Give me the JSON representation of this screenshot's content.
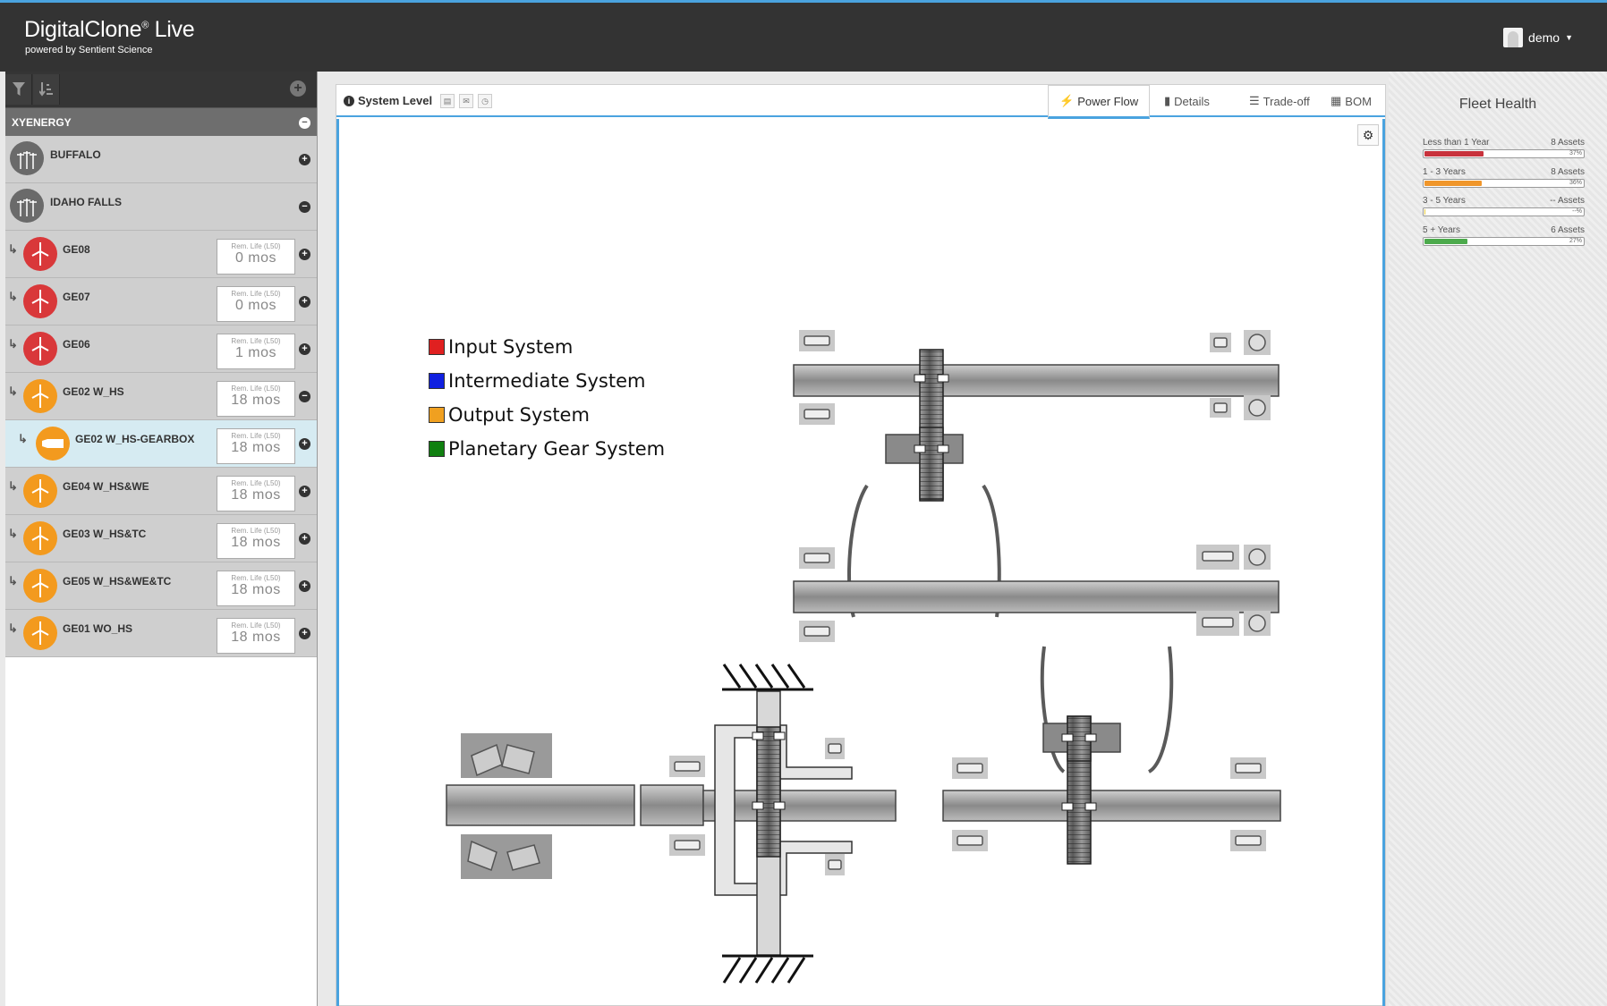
{
  "app": {
    "title": "DigitalClone",
    "title_reg": "®",
    "title_suffix": " Live",
    "subtitle": "powered by Sentient Science",
    "user": "demo"
  },
  "sidebar": {
    "group": "XYENERGY",
    "sites": [
      {
        "name": "BUFFALO"
      },
      {
        "name": "IDAHO FALLS"
      }
    ],
    "life_caption": "Rem. Life (L50)",
    "assets": [
      {
        "name": "GE08",
        "life": "0 mos",
        "status": "red"
      },
      {
        "name": "GE07",
        "life": "0 mos",
        "status": "red"
      },
      {
        "name": "GE06",
        "life": "1 mos",
        "status": "red"
      },
      {
        "name": "GE02 W_HS",
        "life": "18 mos",
        "status": "orange"
      },
      {
        "name": "GE02 W_HS-GEARBOX",
        "life": "18 mos",
        "status": "orange",
        "selected": true
      },
      {
        "name": "GE04 W_HS&WE",
        "life": "18 mos",
        "status": "orange"
      },
      {
        "name": "GE03 W_HS&TC",
        "life": "18 mos",
        "status": "orange"
      },
      {
        "name": "GE05 W_HS&WE&TC",
        "life": "18 mos",
        "status": "orange"
      },
      {
        "name": "GE01 WO_HS",
        "life": "18 mos",
        "status": "orange"
      }
    ]
  },
  "panel": {
    "title": "System Level",
    "tabs": [
      {
        "label": "Power Flow",
        "icon": "bolt-icon"
      },
      {
        "label": "Details",
        "icon": "bar-chart-icon"
      },
      {
        "label": "Trade-off",
        "icon": "tradeoff-icon"
      },
      {
        "label": "BOM",
        "icon": "bom-icon"
      }
    ]
  },
  "legend": [
    {
      "label": "Input System",
      "color": "#e02020"
    },
    {
      "label": "Intermediate System",
      "color": "#1020e0"
    },
    {
      "label": "Output System",
      "color": "#f0a020"
    },
    {
      "label": "Planetary Gear System",
      "color": "#108010"
    }
  ],
  "fleet_health": {
    "title": "Fleet Health",
    "items": [
      {
        "label": "Less than 1 Year",
        "assets": "8 Assets",
        "pct": "37%",
        "fraction": 0.37,
        "color": "#c8323c"
      },
      {
        "label": "1 - 3 Years",
        "assets": "8 Assets",
        "pct": "36%",
        "fraction": 0.36,
        "color": "#f0962a"
      },
      {
        "label": "3 - 5 Years",
        "assets": "-- Assets",
        "pct": "--%",
        "fraction": 0.0,
        "color": "#e6c93a"
      },
      {
        "label": "5 + Years",
        "assets": "6 Assets",
        "pct": "27%",
        "fraction": 0.27,
        "color": "#4caa4c"
      }
    ]
  },
  "colors": {
    "accent": "#4aa3df",
    "status_red": "#d9383a",
    "status_orange": "#f39a1e"
  }
}
